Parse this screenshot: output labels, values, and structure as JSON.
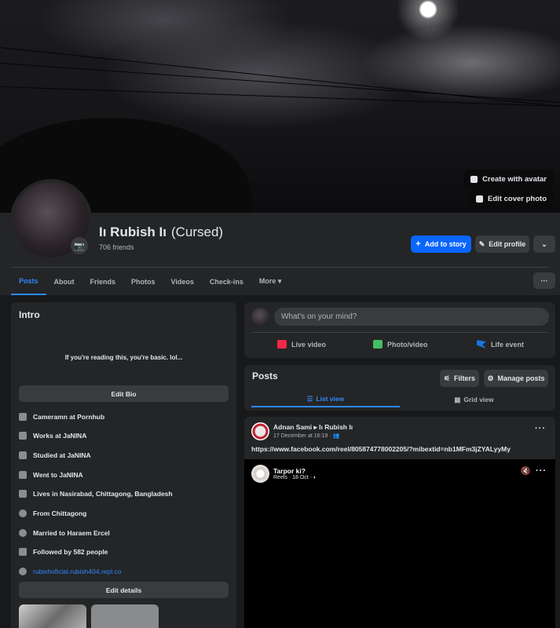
{
  "cover": {
    "create_avatar_label": "Create with avatar",
    "edit_cover_label": "Edit cover photo"
  },
  "profile": {
    "name": "Iı Rubish Iı",
    "nickname": "(Cursed)",
    "friends": "706 friends"
  },
  "actions": {
    "add_story": "Add to story",
    "edit_profile": "Edit profile",
    "more_dots": "···"
  },
  "tabs": [
    {
      "label": "Posts"
    },
    {
      "label": "About"
    },
    {
      "label": "Friends"
    },
    {
      "label": "Photos"
    },
    {
      "label": "Videos"
    },
    {
      "label": "Check-ins"
    },
    {
      "label": "More ▾"
    }
  ],
  "intro": {
    "title": "Intro",
    "bio": "If you're reading this, you're basic. lol...",
    "edit_bio": "Edit Bio",
    "details": [
      {
        "icon": "briefcase-icon",
        "text": "Cameramn at Pornhub"
      },
      {
        "icon": "briefcase-icon",
        "text": "Works at JaNINA"
      },
      {
        "icon": "graduation-cap-icon",
        "text": "Studied at JaNINA"
      },
      {
        "icon": "graduation-cap-icon",
        "text": "Went to JaNINA"
      },
      {
        "icon": "home-icon",
        "text": "Lives in Nasirabad, Chittagong, Bangladesh"
      },
      {
        "icon": "location-pin-icon",
        "text": "From Chittagong"
      },
      {
        "icon": "heart-icon",
        "text": "Married to Haraem Ercel"
      },
      {
        "icon": "rss-icon",
        "text": "Followed by 582 people"
      },
      {
        "icon": "globe-icon",
        "text": "rubishoficial.rubish404.repl.co"
      }
    ],
    "edit_details": "Edit details"
  },
  "composer": {
    "placeholder": "What's on your mind?",
    "live_video": "Live video",
    "photo_video": "Photo/video",
    "life_event": "Life event"
  },
  "posts": {
    "title": "Posts",
    "filters": "Filters",
    "manage": "Manage posts",
    "list_view": "List view",
    "grid_view": "Grid view"
  },
  "post": {
    "author": "Adnan Sami ▸ Iı Rubish Iı",
    "meta": "17 December at 16:19 · 👥",
    "text": "https://www.facebook.com/reel/805874778002205/?mibextid=nb1MFm3jZYALyyMy",
    "reel_title": "Tarpor ki?",
    "reel_meta": "Reels · 18 Oct · ◐",
    "dots": "···"
  },
  "colors": {
    "accent": "#0866ff",
    "link": "#2d88ff",
    "card": "#242526",
    "background": "#18191a",
    "button": "#3a3b3c"
  }
}
